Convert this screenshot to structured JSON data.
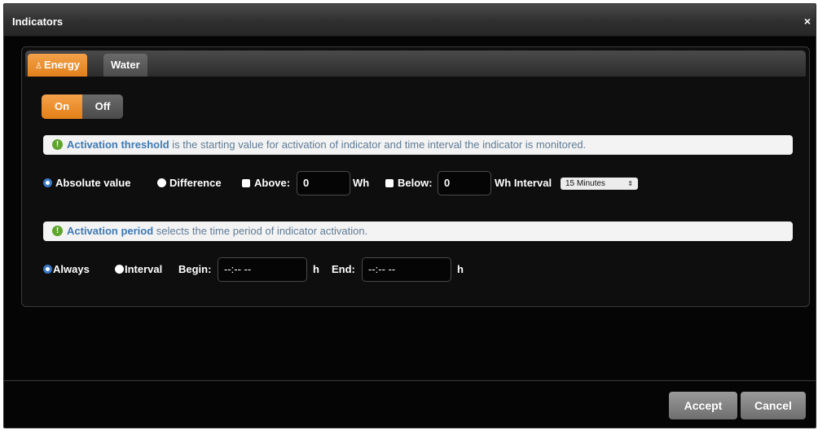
{
  "dialog": {
    "title": "Indicators",
    "close_label": "×",
    "accept_label": "Accept",
    "cancel_label": "Cancel"
  },
  "tabs": [
    {
      "label": "Energy",
      "active": true,
      "icon": "user-icon"
    },
    {
      "label": "Water",
      "active": false
    }
  ],
  "toggle": {
    "on_label": "On",
    "off_label": "Off",
    "selected": "On"
  },
  "threshold": {
    "info_bold": "Activation threshold",
    "info_text": " is the starting value for activation of indicator and time interval the indicator is monitored.",
    "absolute_label": "Absolute value",
    "difference_label": "Difference",
    "selected_mode": "Absolute value",
    "above_label": "Above:",
    "above_value": "0",
    "above_unit": "Wh",
    "below_label": "Below:",
    "below_value": "0",
    "below_unit": "Wh Interval",
    "interval_value": "15 Minutes"
  },
  "period": {
    "info_bold": "Activation period",
    "info_text": " selects the time period of indicator activation.",
    "always_label": "Always",
    "interval_label": "Interval",
    "selected_mode": "Always",
    "begin_label": "Begin:",
    "begin_value": "--:-- --",
    "begin_unit": "h",
    "end_label": "End:",
    "end_value": "--:-- --",
    "end_unit": "h"
  },
  "colors": {
    "accent": "#e8891f",
    "info_text": "#3e7ab5",
    "info_icon": "#5ea42d"
  }
}
